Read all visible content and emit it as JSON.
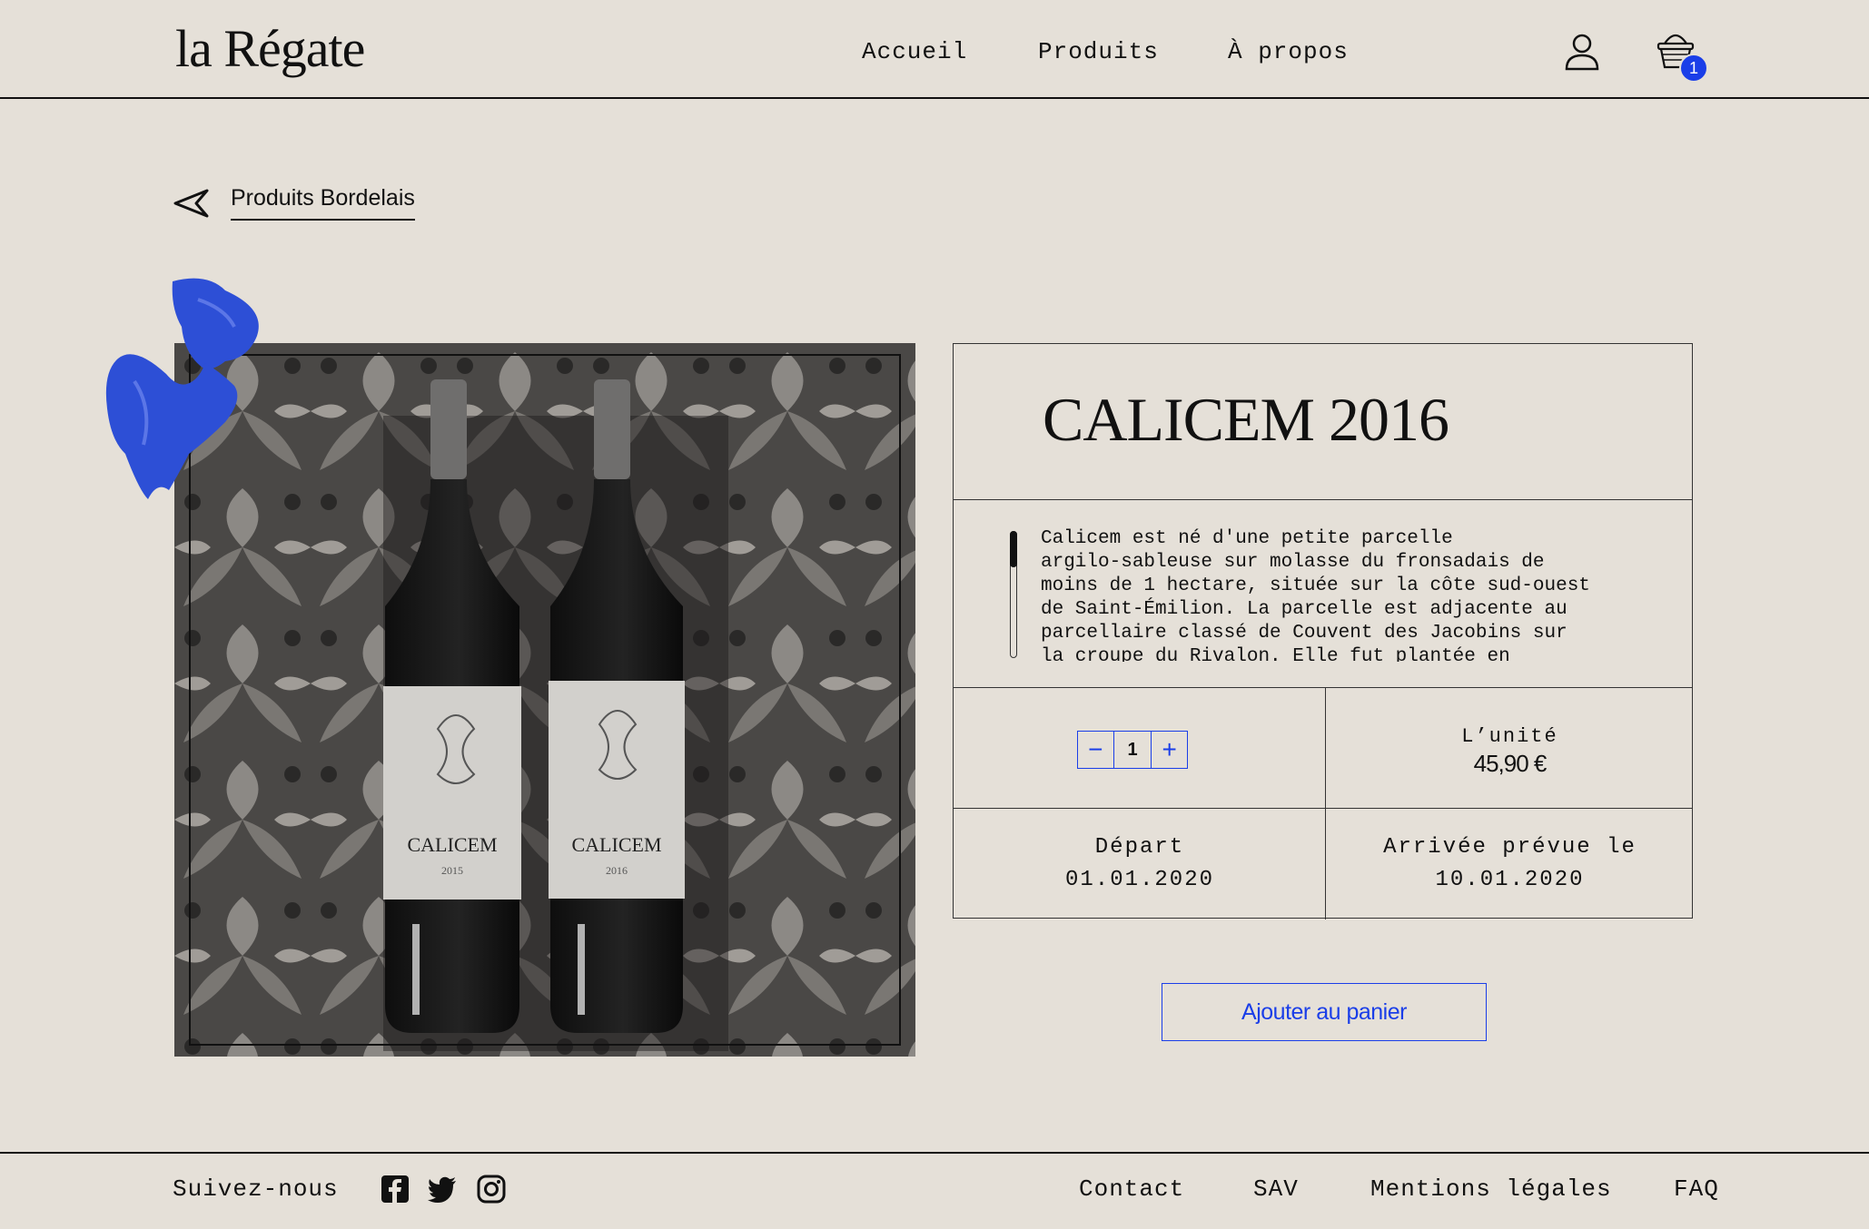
{
  "header": {
    "logo": "la Régate",
    "nav": [
      "Accueil",
      "Produits",
      "À propos"
    ],
    "cart_count": "1",
    "icons": [
      "user-icon",
      "basket-icon"
    ]
  },
  "breadcrumb": {
    "label": "Produits Bordelais",
    "icon": "back-arrow-icon"
  },
  "product": {
    "photo_labels": [
      {
        "name": "CALICEM",
        "year": "2015"
      },
      {
        "name": "CALICEM",
        "year": "2016"
      }
    ],
    "title": "CALICEM 2016",
    "description": "Calicem est né d'une petite parcelle\nargilo-sableuse sur molasse du fronsadais de\nmoins de 1 hectare, située sur la côte sud-ouest\nde Saint-Émilion. La parcelle est adjacente au\nparcellaire classé de Couvent des Jacobins sur\nla croupe du Rivalon. Elle fut plantée en",
    "quantity": "1",
    "qty_minus": "−",
    "qty_plus": "+",
    "unit_label": "L’unité",
    "price": "45,90 €",
    "depart_label": "Départ",
    "depart_date": "01.01.2020",
    "arrive_label": "Arrivée prévue le",
    "arrive_date": "10.01.2020",
    "add_to_cart": "Ajouter au panier"
  },
  "footer": {
    "follow": "Suivez-nous",
    "social": [
      "facebook-icon",
      "twitter-icon",
      "instagram-icon"
    ],
    "links": [
      "Contact",
      "SAV",
      "Mentions légales",
      "FAQ"
    ]
  },
  "colors": {
    "accent": "#1a3ee8",
    "background": "#e5e0d8",
    "ink": "#111111"
  }
}
